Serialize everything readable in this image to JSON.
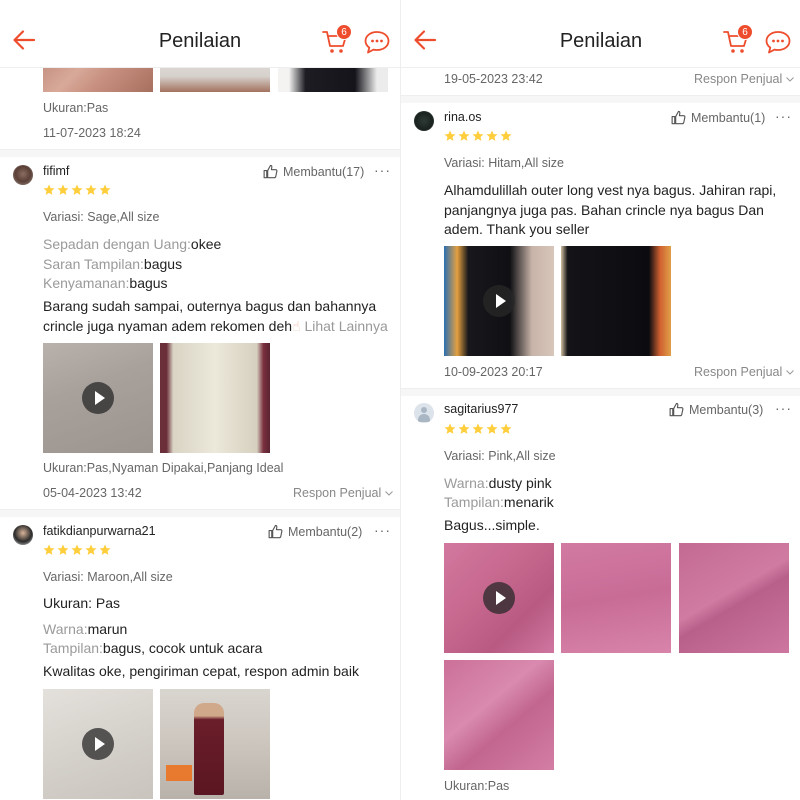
{
  "header": {
    "title": "Penilaian",
    "cart_count": "6"
  },
  "left": {
    "top_review": {
      "size": "Ukuran:Pas",
      "date": "11-07-2023 18:24"
    },
    "review1": {
      "username": "fifimf",
      "helpful": "Membantu(17)",
      "variant": "Variasi: Sage,All size",
      "attr1_label": "Sepadan dengan Uang:",
      "attr1_value": "okee",
      "attr2_label": "Saran Tampilan:",
      "attr2_value": "bagus",
      "attr3_label": "Kenyamanan:",
      "attr3_value": "bagus",
      "body_line1": "Barang sudah sampai, outernya bagus dan bahannya",
      "body_line2": "crincle juga nyaman adem rekomen deh",
      "see_more": "Lihat Lainnya",
      "tags": "Ukuran:Pas,Nyaman Dipakai,Panjang Ideal",
      "date": "05-04-2023 13:42",
      "seller_reply": "Respon Penjual"
    },
    "review2": {
      "username": "fatikdianpurwarna21",
      "helpful": "Membantu(2)",
      "variant": "Variasi: Maroon,All size",
      "size_line": "Ukuran: Pas",
      "attr1_label": "Warna:",
      "attr1_value": "marun",
      "attr2_label": "Tampilan:",
      "attr2_value": "bagus, cocok untuk acara",
      "body": "Kwalitas oke, pengiriman cepat, respon admin baik"
    }
  },
  "right": {
    "top_review": {
      "date": "19-05-2023 23:42",
      "seller_reply": "Respon Penjual"
    },
    "review1": {
      "username": "rina.os",
      "helpful": "Membantu(1)",
      "variant": "Variasi: Hitam,All size",
      "body_line1": "Alhamdulillah outer long vest nya bagus. Jahiran rapi,",
      "body_line2": "panjangnya juga pas. Bahan crincle nya bagus Dan",
      "body_line3": "adem. Thank you seller",
      "date": "10-09-2023 20:17",
      "seller_reply": "Respon Penjual"
    },
    "review2": {
      "username": "sagitarius977",
      "helpful": "Membantu(3)",
      "variant": "Variasi: Pink,All size",
      "attr1_label": "Warna:",
      "attr1_value": "dusty pink",
      "attr2_label": "Tampilan:",
      "attr2_value": "menarik",
      "body": "Bagus...simple.",
      "size": "Ukuran:Pas"
    }
  },
  "rating": 5,
  "colors": {
    "accent": "#ee4d2d",
    "star": "#ffce3d"
  },
  "icons": [
    "back-arrow-icon",
    "cart-icon",
    "chat-icon",
    "thumbs-up-icon",
    "more-icon",
    "play-icon",
    "chevron-down-icon",
    "star-icon"
  ]
}
